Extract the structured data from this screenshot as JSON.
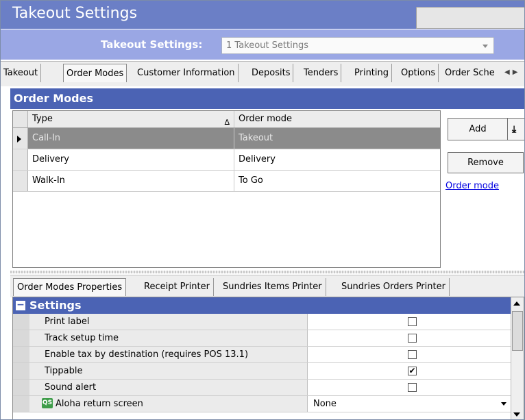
{
  "window": {
    "title": "Takeout Settings"
  },
  "selector": {
    "label": "Takeout Settings:",
    "value": "1 Takeout Settings"
  },
  "tabs": [
    {
      "label": "Takeout"
    },
    {
      "label": "Order Modes",
      "active": true
    },
    {
      "label": "Customer Information"
    },
    {
      "label": "Deposits"
    },
    {
      "label": "Tenders"
    },
    {
      "label": "Printing"
    },
    {
      "label": "Options"
    },
    {
      "label": "Order Sche"
    }
  ],
  "order_modes": {
    "header": "Order Modes",
    "columns": [
      "Type",
      "Order mode"
    ],
    "sort_indicator": "∆",
    "rows": [
      {
        "type": "Call-In",
        "order_mode": "Takeout",
        "selected": true
      },
      {
        "type": "Delivery",
        "order_mode": "Delivery"
      },
      {
        "type": "Walk-In",
        "order_mode": "To Go"
      }
    ]
  },
  "actions": {
    "add": "Add",
    "remove": "Remove",
    "link": "Order mode"
  },
  "lower_tabs": [
    {
      "label": "Order Modes Properties",
      "active": true
    },
    {
      "label": "Receipt Printer"
    },
    {
      "label": "Sundries Items Printer"
    },
    {
      "label": "Sundries Orders Printer"
    }
  ],
  "properties": {
    "category": "Settings",
    "items": [
      {
        "name": "Print label",
        "checked": false
      },
      {
        "name": "Track setup time",
        "checked": false
      },
      {
        "name": "Enable tax by destination (requires POS 13.1)",
        "checked": false
      },
      {
        "name": "Tippable",
        "checked": true
      },
      {
        "name": "Sound alert",
        "checked": false
      },
      {
        "name": "Aloha return screen",
        "value": "None",
        "icon": "QS"
      }
    ]
  }
}
